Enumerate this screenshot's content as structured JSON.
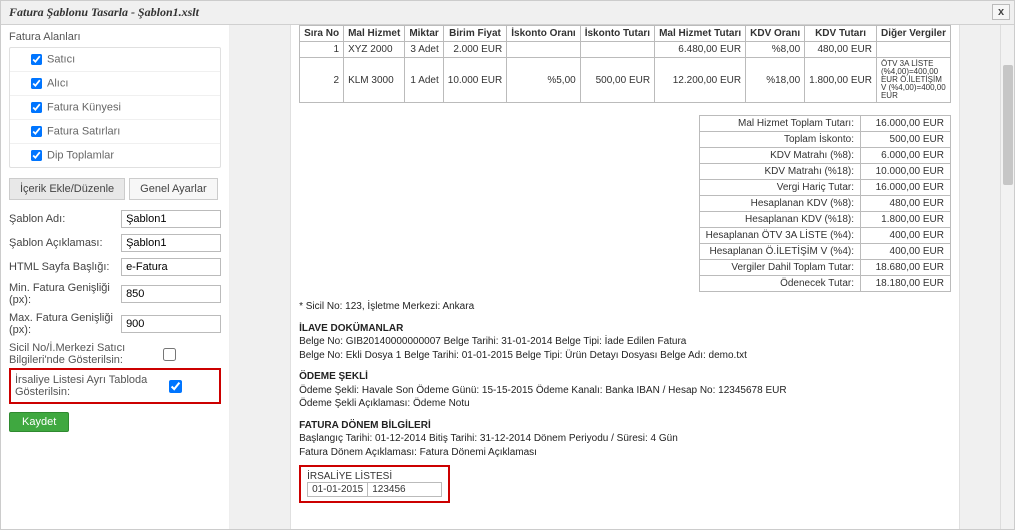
{
  "window": {
    "title": "Fatura Şablonu Tasarla - Şablon1.xslt",
    "close": "x"
  },
  "leftPanel": {
    "fieldsHeader": "Fatura Alanları",
    "tree": [
      {
        "label": "Satıcı",
        "checked": true
      },
      {
        "label": "Alıcı",
        "checked": true
      },
      {
        "label": "Fatura Künyesi",
        "checked": true
      },
      {
        "label": "Fatura Satırları",
        "checked": true
      },
      {
        "label": "Dip Toplamlar",
        "checked": true
      }
    ],
    "tabs": {
      "content": "İçerik Ekle/Düzenle",
      "general": "Genel Ayarlar"
    },
    "form": {
      "templateNameLabel": "Şablon Adı:",
      "templateName": "Şablon1",
      "templateDescLabel": "Şablon Açıklaması:",
      "templateDesc": "Şablon1",
      "htmlTitleLabel": "HTML Sayfa Başlığı:",
      "htmlTitle": "e-Fatura",
      "minWidthLabel": "Min. Fatura Genişliği (px):",
      "minWidth": "850",
      "maxWidthLabel": "Max. Fatura Genişliği (px):",
      "maxWidth": "900",
      "sicilLabel": "Sicil No/İ.Merkezi Satıcı Bilgileri'nde Gösterilsin:",
      "irsaliyeLabel": "İrsaliye Listesi Ayrı Tabloda Gösterilsin:"
    },
    "save": "Kaydet"
  },
  "items": {
    "headers": {
      "sira": "Sıra No",
      "mal": "Mal Hizmet",
      "miktar": "Miktar",
      "birim": "Birim Fiyat",
      "iskOran": "İskonto Oranı",
      "iskTut": "İskonto Tutarı",
      "malTut": "Mal Hizmet Tutarı",
      "kdvOran": "KDV Oranı",
      "kdvTut": "KDV Tutarı",
      "diger": "Diğer Vergiler"
    },
    "rows": [
      {
        "sira": "1",
        "mal": "XYZ 2000",
        "miktar": "3 Adet",
        "birim": "2.000 EUR",
        "iskOran": "",
        "iskTut": "",
        "malTut": "6.480,00 EUR",
        "kdvOran": "%8,00",
        "kdvTut": "480,00 EUR",
        "diger": ""
      },
      {
        "sira": "2",
        "mal": "KLM 3000",
        "miktar": "1 Adet",
        "birim": "10.000 EUR",
        "iskOran": "%5,00",
        "iskTut": "500,00 EUR",
        "malTut": "12.200,00 EUR",
        "kdvOran": "%18,00",
        "kdvTut": "1.800,00 EUR",
        "diger": "ÖTV 3A LİSTE (%4,00)=400,00 EUR Ö.İLETİŞİM V (%4,00)=400,00 EUR"
      }
    ]
  },
  "totals": [
    {
      "k": "Mal Hizmet Toplam Tutarı:",
      "v": "16.000,00 EUR"
    },
    {
      "k": "Toplam İskonto:",
      "v": "500,00 EUR"
    },
    {
      "k": "KDV Matrahı (%8):",
      "v": "6.000,00 EUR"
    },
    {
      "k": "KDV Matrahı (%18):",
      "v": "10.000,00 EUR"
    },
    {
      "k": "Vergi Hariç Tutar:",
      "v": "16.000,00 EUR"
    },
    {
      "k": "Hesaplanan KDV (%8):",
      "v": "480,00 EUR"
    },
    {
      "k": "Hesaplanan KDV (%18):",
      "v": "1.800,00 EUR"
    },
    {
      "k": "Hesaplanan ÖTV 3A LİSTE (%4):",
      "v": "400,00 EUR"
    },
    {
      "k": "Hesaplanan Ö.İLETİŞİM V (%4):",
      "v": "400,00 EUR"
    },
    {
      "k": "Vergiler Dahil Toplam Tutar:",
      "v": "18.680,00 EUR"
    },
    {
      "k": "Ödenecek Tutar:",
      "v": "18.180,00 EUR"
    }
  ],
  "footer": {
    "sicil": "* Sicil No: 123, İşletme Merkezi: Ankara",
    "ilave": {
      "hd": "İLAVE DOKÜMANLAR",
      "l1": "Belge No:  GIB20140000000007   Belge Tarihi:  31-01-2014   Belge Tipi:  İade Edilen Fatura",
      "l2": "Belge No:  Ekli Dosya 1   Belge Tarihi:  01-01-2015   Belge Tipi:  Ürün Detayı Dosyası   Belge Adı:  demo.txt"
    },
    "odeme": {
      "hd": "ÖDEME ŞEKLİ",
      "l1": "Ödeme Şekli:  Havale   Son Ödeme Günü:  15-15-2015   Ödeme Kanalı:  Banka   IBAN / Hesap No:  12345678  EUR",
      "l2": "Ödeme Şekli Açıklaması:  Ödeme Notu"
    },
    "donem": {
      "hd": "FATURA DÖNEM BİLGİLERİ",
      "l1": "Başlangıç Tarihi:  01-12-2014   Bitiş Tarihi:  31-12-2014   Dönem Periyodu / Süresi:  4  Gün",
      "l2": "Fatura Dönem Açıklaması:  Fatura Dönemi Açıklaması"
    },
    "irsaliye": {
      "hd": "İRSALİYE LİSTESİ",
      "date": "01-01-2015",
      "no": "123456"
    }
  }
}
